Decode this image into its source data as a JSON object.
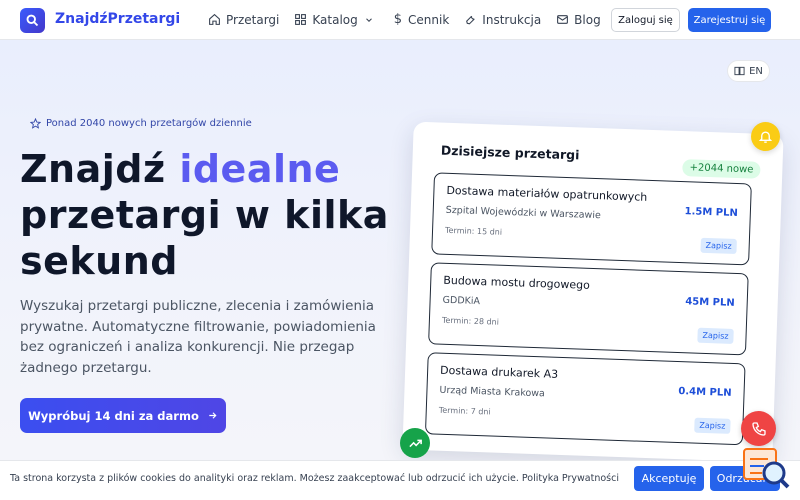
{
  "header": {
    "logo_text": "ZnajdźPrzetargi",
    "nav": [
      {
        "label": "Przetargi",
        "icon": "home-icon"
      },
      {
        "label": "Katalog",
        "icon": "grid-icon"
      },
      {
        "label": "Cennik",
        "icon": "dollar-icon"
      },
      {
        "label": "Instrukcja",
        "icon": "tool-icon"
      },
      {
        "label": "Blog",
        "icon": "mail-icon"
      }
    ],
    "login_label": "Zaloguj się",
    "register_label": "Zarejestruj się"
  },
  "lang": "EN",
  "hero": {
    "badge": "Ponad 2040 nowych przetargów dziennie",
    "title_before": "Znajdź ",
    "title_accent": "idealne",
    "title_after": " przetargi w kilka sekund",
    "description": "Wyszukaj przetargi publiczne, zlecenia i zamówienia prywatne. Automatyczne filtrowanie, powiadomienia bez ograniczeń i analiza konkurencji. Nie przegap żadnego przetargu.",
    "cta": "Wypróbuj 14 dni za darmo"
  },
  "card": {
    "title": "Dzisiejsze przetargi",
    "new_badge": "+2044 nowe",
    "items": [
      {
        "title": "Dostawa materiałów opatrunkowych",
        "org": "Szpital Wojewódzki w Warszawie",
        "term": "Termin: 15 dni",
        "price": "1.5M PLN",
        "save": "Zapisz"
      },
      {
        "title": "Budowa mostu drogowego",
        "org": "GDDKiA",
        "term": "Termin: 28 dni",
        "price": "45M PLN",
        "save": "Zapisz"
      },
      {
        "title": "Dostawa drukarek A3",
        "org": "Urząd Miasta Krakowa",
        "term": "Termin: 7 dni",
        "price": "0.4M PLN",
        "save": "Zapisz"
      }
    ]
  },
  "cookie": {
    "text": "Ta strona korzysta z plików cookies do analityki oraz reklam. Możesz zaakceptować lub odrzucić ich użycie. Polityka Prywatności",
    "accept": "Akceptuję",
    "reject": "Odrzucam"
  },
  "colors": {
    "primary": "#2563eb",
    "accent": "#5b5bf0",
    "bell": "#facc15",
    "phone": "#ef4444",
    "trend": "#16a34a"
  }
}
